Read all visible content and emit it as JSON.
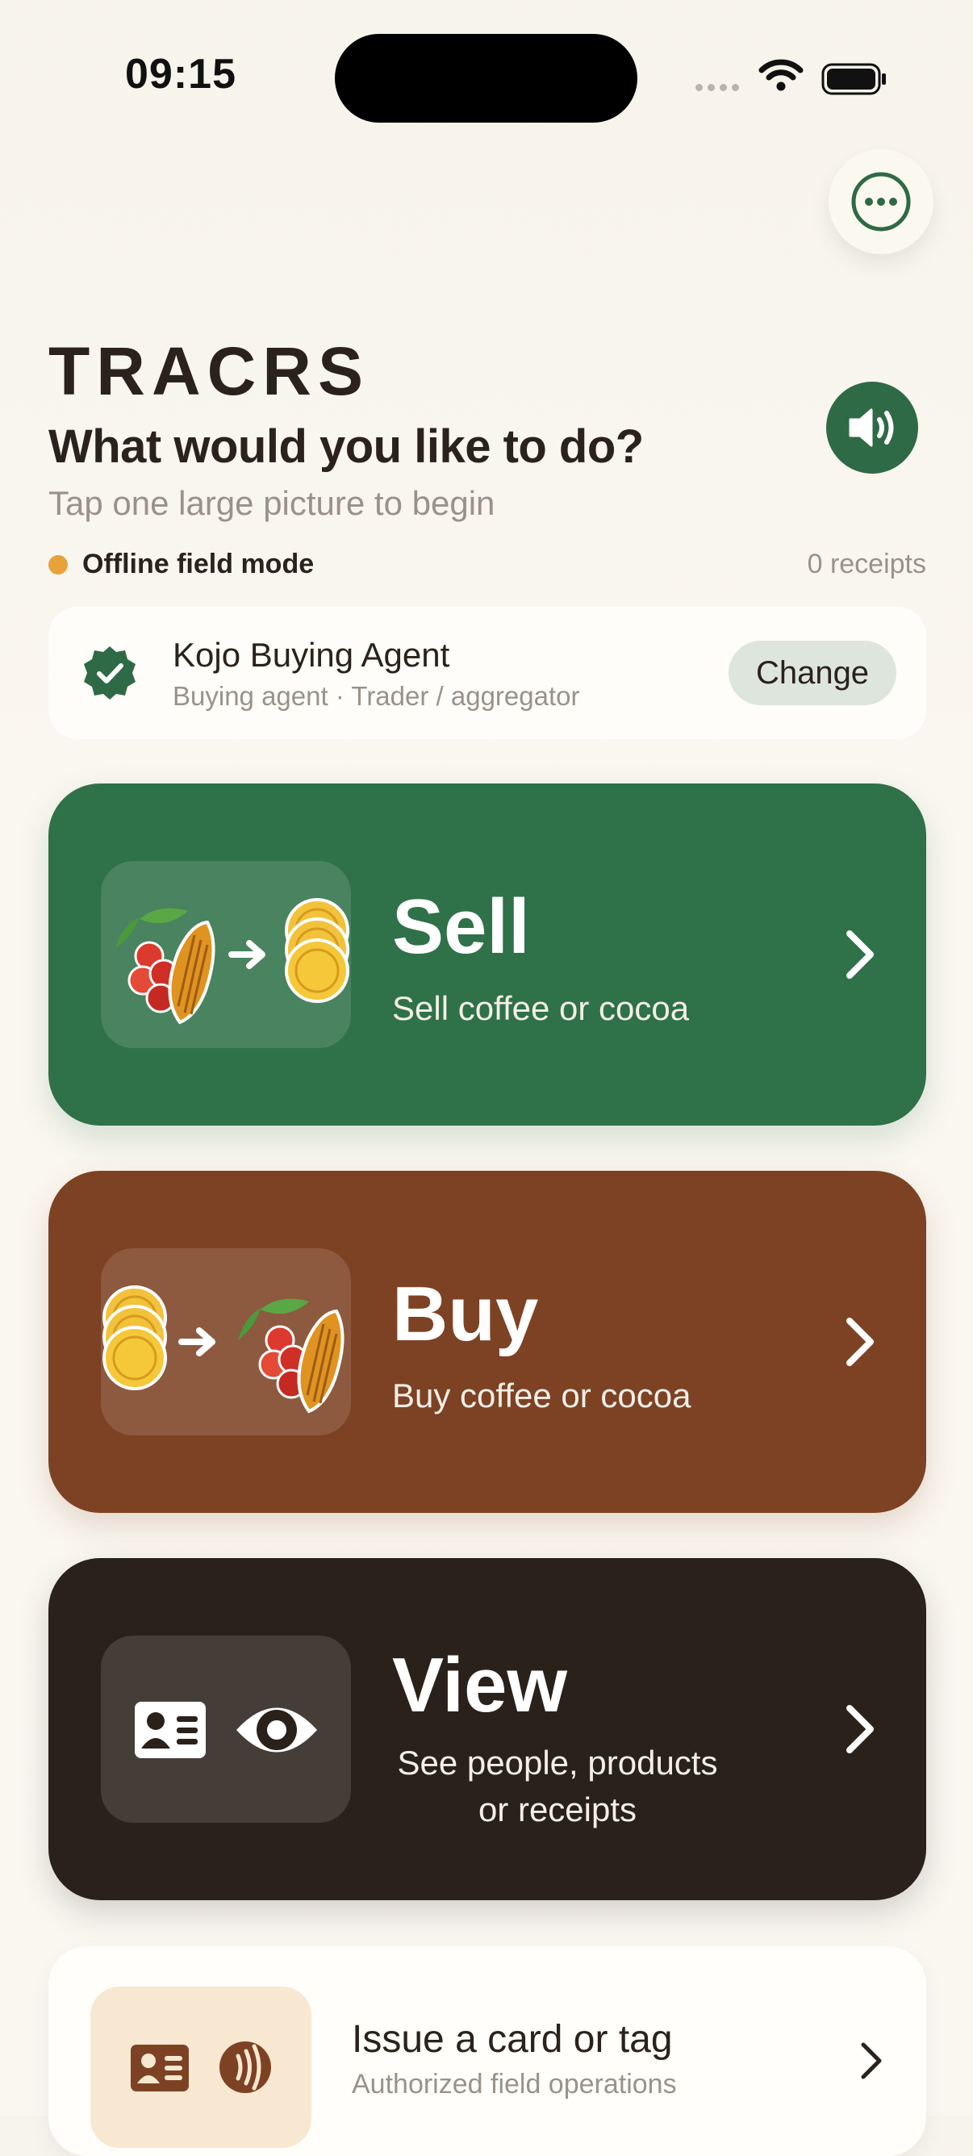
{
  "status_bar": {
    "time": "09:15"
  },
  "header": {
    "brand": "TRACRS",
    "prompt": "What would you like to do?",
    "hint": "Tap one large picture to begin"
  },
  "mode": {
    "label": "Offline field mode",
    "receipts": "0 receipts",
    "dot_color": "#e8a23a"
  },
  "agent": {
    "name": "Kojo Buying Agent",
    "role": "Buying agent · Trader / aggregator",
    "change_label": "Change"
  },
  "actions": [
    {
      "title": "Sell",
      "subtitle": "Sell coffee or cocoa",
      "color": "#2f7148",
      "icon": "produce-to-coins-icon"
    },
    {
      "title": "Buy",
      "subtitle": "Buy coffee or cocoa",
      "color": "#7d4224",
      "icon": "coins-to-produce-icon"
    },
    {
      "title": "View",
      "subtitle_line1": "See people, products",
      "subtitle_line2": "or receipts",
      "color": "#2a211b",
      "icon": "id-card-eye-icon"
    }
  ],
  "issue": {
    "title": "Issue a card or tag",
    "subtitle": "Authorized field operations",
    "icon": "id-card-nfc-icon"
  },
  "colors": {
    "green": "#2e6a45",
    "brown": "#7d4224",
    "dark": "#2a211b",
    "background": "#f8f5ed"
  }
}
